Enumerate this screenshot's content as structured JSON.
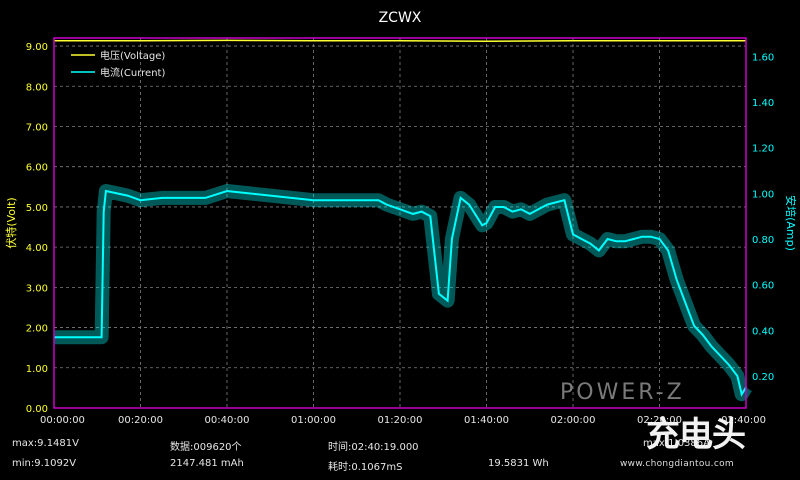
{
  "chart_data": {
    "type": "line",
    "title": "ZCWX",
    "x_ticks": [
      "00:00:00",
      "00:20:00",
      "00:40:00",
      "01:00:00",
      "01:20:00",
      "01:40:00",
      "02:00:00",
      "02:20:00",
      "02:40:00"
    ],
    "y_left": {
      "label": "伏特(Volt)",
      "ticks": [
        "0.00",
        "1.00",
        "2.00",
        "3.00",
        "4.00",
        "5.00",
        "6.00",
        "7.00",
        "8.00",
        "9.00"
      ],
      "range": [
        0,
        9.2
      ]
    },
    "y_right": {
      "label": "安培(Amp)",
      "ticks": [
        "0.20",
        "0.40",
        "0.60",
        "0.80",
        "1.00",
        "1.20",
        "1.40",
        "1.60"
      ],
      "range": [
        0.06,
        1.68
      ]
    },
    "legend": {
      "position": "top-left",
      "voltage": "电压(Voltage)",
      "current": "电流(Current)"
    },
    "colors": {
      "voltage": "#ffff33",
      "current": "#00ffff",
      "axis_left": "#ffff33",
      "axis_right": "#00ffff",
      "border": "#c800c8",
      "grid": "#808080"
    },
    "grid": true,
    "series": [
      {
        "name": "电压(Voltage)",
        "axis": "left",
        "x": [
          0,
          10,
          20,
          40,
          60,
          80,
          100,
          120,
          140,
          160
        ],
        "y": [
          9.13,
          9.13,
          9.13,
          9.14,
          9.13,
          9.13,
          9.12,
          9.13,
          9.13,
          9.13
        ]
      },
      {
        "name": "电流(Current)",
        "axis": "right",
        "x": [
          0,
          10,
          11,
          11.5,
          12,
          17,
          20,
          25,
          30,
          35,
          40,
          50,
          60,
          70,
          75,
          77,
          80,
          83,
          85,
          87,
          89,
          91,
          92,
          94,
          96,
          99,
          100,
          102,
          104,
          106,
          108,
          110,
          112,
          114,
          116,
          118,
          120,
          122,
          124,
          126,
          128,
          130,
          132,
          134,
          136,
          138,
          140,
          142,
          144,
          146,
          148,
          150,
          152,
          154,
          156,
          158,
          159,
          160
        ],
        "y": [
          0.37,
          0.37,
          0.37,
          0.92,
          1.01,
          0.99,
          0.97,
          0.98,
          0.98,
          0.98,
          1.01,
          0.99,
          0.97,
          0.97,
          0.97,
          0.95,
          0.93,
          0.91,
          0.92,
          0.9,
          0.56,
          0.53,
          0.8,
          0.98,
          0.95,
          0.86,
          0.87,
          0.94,
          0.94,
          0.92,
          0.93,
          0.91,
          0.93,
          0.95,
          0.96,
          0.97,
          0.82,
          0.8,
          0.78,
          0.75,
          0.8,
          0.79,
          0.79,
          0.8,
          0.81,
          0.81,
          0.8,
          0.75,
          0.62,
          0.52,
          0.42,
          0.38,
          0.33,
          0.29,
          0.25,
          0.2,
          0.12,
          0.15
        ]
      }
    ]
  },
  "stats": {
    "max_v": "max:9.1481V",
    "min_v": "min:9.1092V",
    "count": "数据:009620个",
    "mah": "2147.481 mAh",
    "time": "时间:02:40:19.000",
    "interval": "耗时:0.1067mS",
    "wh": "19.5831 Wh",
    "max_a": "max:1.0386A"
  },
  "watermark": {
    "power_z": "POWER-Z",
    "site": "www.chongdiantou.com",
    "logo_text": "充电头"
  }
}
